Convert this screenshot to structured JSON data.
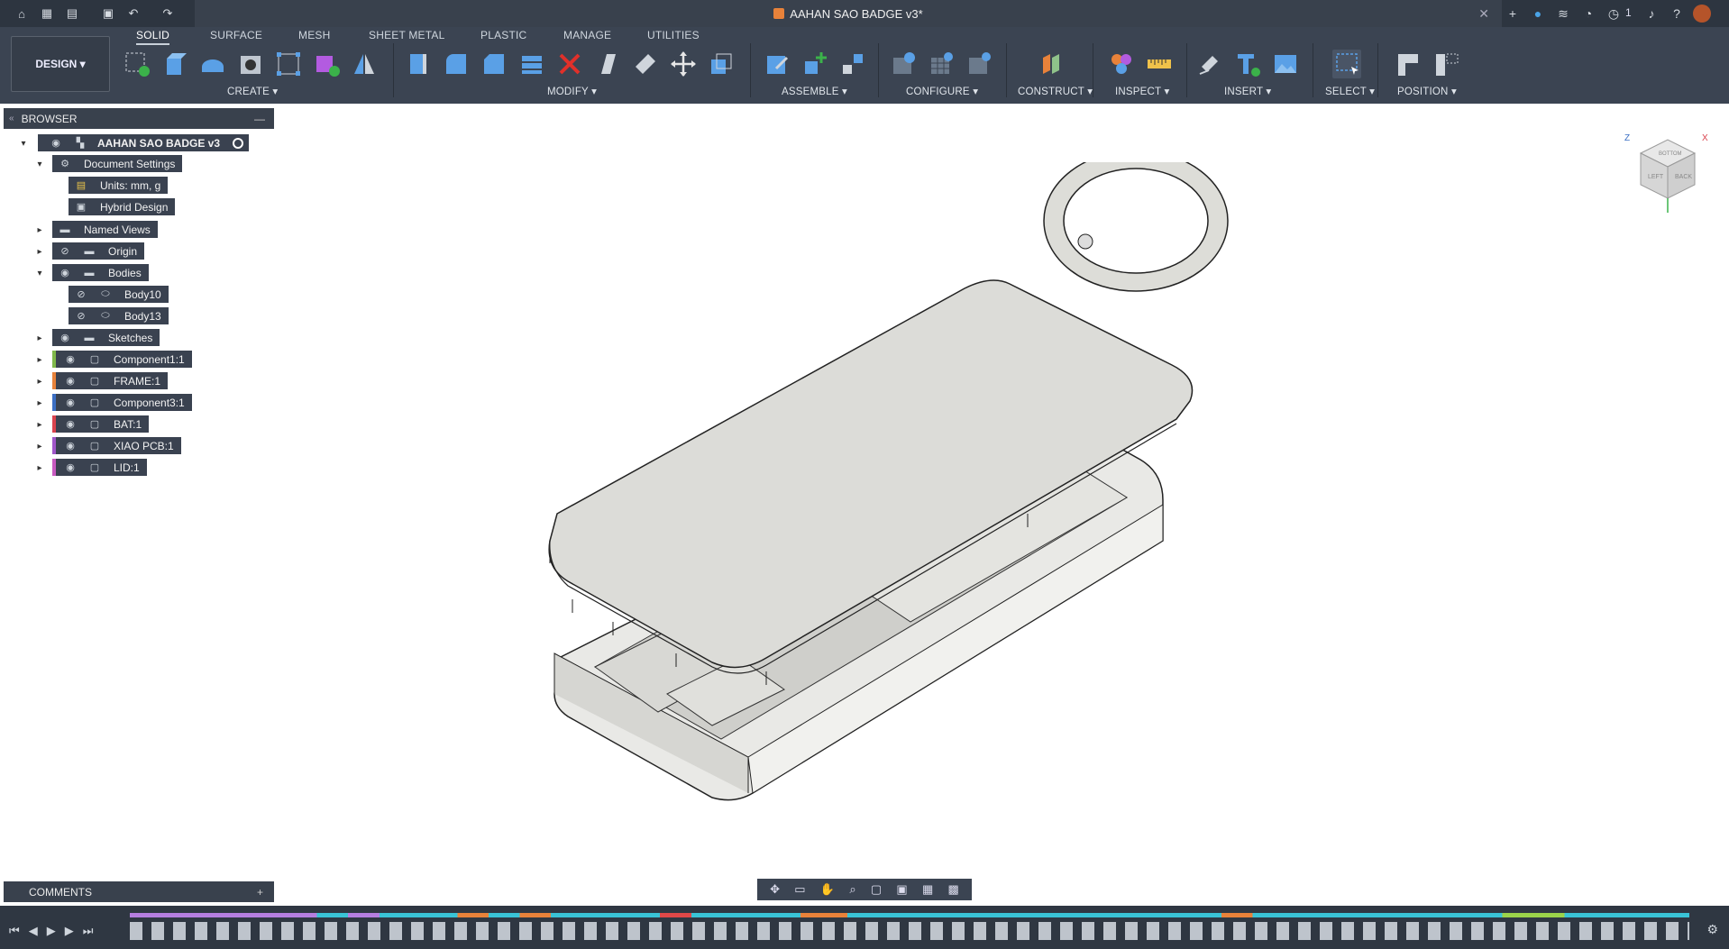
{
  "titlebar": {
    "document_title": "AAHAN SAO BADGE v3*",
    "notifications_count": "1"
  },
  "workspace": {
    "label": "DESIGN"
  },
  "tabs": [
    {
      "label": "SOLID",
      "active": true
    },
    {
      "label": "SURFACE"
    },
    {
      "label": "MESH"
    },
    {
      "label": "SHEET METAL"
    },
    {
      "label": "PLASTIC"
    },
    {
      "label": "MANAGE"
    },
    {
      "label": "UTILITIES"
    }
  ],
  "tool_groups": [
    {
      "label": "CREATE"
    },
    {
      "label": "MODIFY"
    },
    {
      "label": "ASSEMBLE"
    },
    {
      "label": "CONFIGURE"
    },
    {
      "label": "CONSTRUCT"
    },
    {
      "label": "INSPECT"
    },
    {
      "label": "INSERT"
    },
    {
      "label": "SELECT"
    },
    {
      "label": "POSITION"
    }
  ],
  "browser": {
    "title": "BROWSER",
    "root": "AAHAN SAO BADGE v3",
    "items": [
      {
        "label": "Document Settings"
      },
      {
        "label": "Units: mm, g"
      },
      {
        "label": "Hybrid Design"
      },
      {
        "label": "Named Views"
      },
      {
        "label": "Origin"
      },
      {
        "label": "Bodies"
      },
      {
        "label": "Body10"
      },
      {
        "label": "Body13"
      },
      {
        "label": "Sketches"
      },
      {
        "label": "Component1:1",
        "color": "#7fb84a"
      },
      {
        "label": "FRAME:1",
        "color": "#e8823a"
      },
      {
        "label": "Component3:1",
        "color": "#3b6fc4"
      },
      {
        "label": "BAT:1",
        "color": "#d9434e"
      },
      {
        "label": "XIAO PCB:1",
        "color": "#a056c9"
      },
      {
        "label": "LID:1",
        "color": "#c85ac0"
      }
    ]
  },
  "comments": {
    "title": "COMMENTS"
  },
  "viewcube": {
    "faces": [
      "LEFT",
      "BACK",
      "BOTTOM"
    ],
    "axes": [
      "Z",
      "X"
    ]
  },
  "colors": {
    "accent": "#0696d7",
    "toolbar_bg": "#3b4452",
    "titlebar_bg": "#2d3540"
  }
}
